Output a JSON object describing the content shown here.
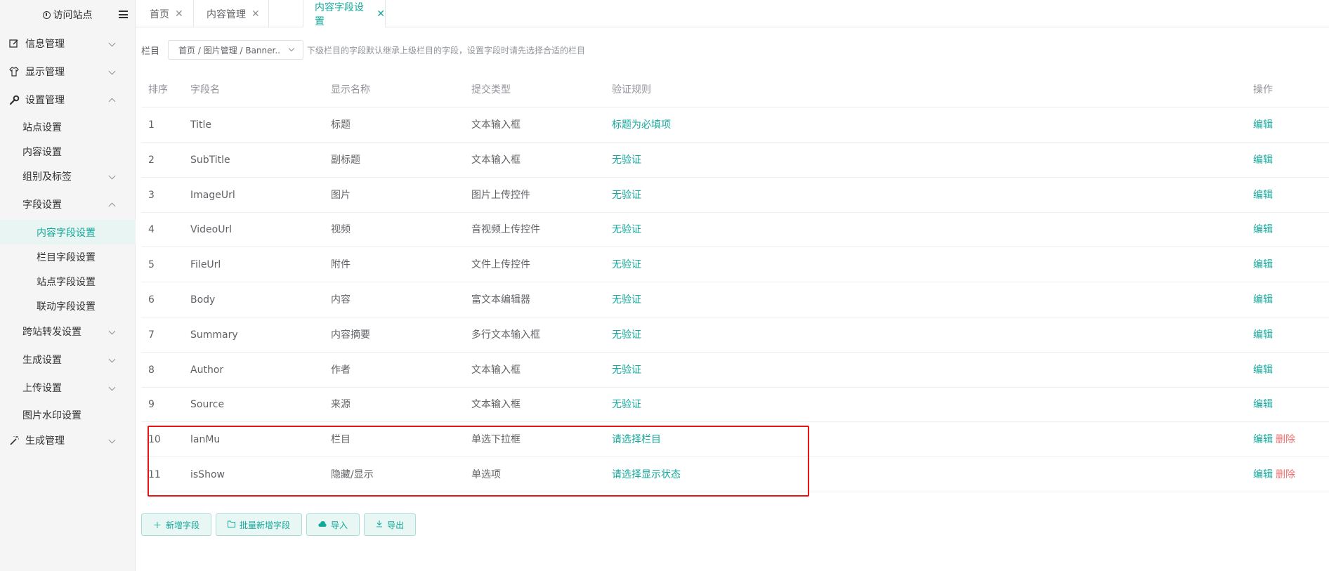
{
  "sidebar": {
    "visit_site": "访问站点",
    "menus": [
      {
        "label": "信息管理",
        "icon": "edit-icon"
      },
      {
        "label": "显示管理",
        "icon": "shirt-icon"
      },
      {
        "label": "设置管理",
        "icon": "wrench-icon"
      }
    ],
    "settings_children": {
      "site_settings": "站点设置",
      "content_settings": "内容设置",
      "groups_tags": "组别及标签",
      "field_settings": "字段设置",
      "field_children": [
        "内容字段设置",
        "栏目字段设置",
        "站点字段设置",
        "联动字段设置"
      ],
      "cross_site": "跨站转发设置",
      "generate_settings": "生成设置",
      "upload_settings": "上传设置",
      "watermark_settings": "图片水印设置"
    },
    "generate_management": "生成管理"
  },
  "tabs": [
    {
      "label": "首页",
      "close": "✕"
    },
    {
      "label": "内容管理",
      "close": "✕"
    },
    {
      "label": "内容字段设置",
      "close": "✕"
    }
  ],
  "filter": {
    "label": "栏目",
    "value": "首页 / 图片管理 / Banner...",
    "hint": "下级栏目的字段默认继承上级栏目的字段，设置字段时请先选择合适的栏目"
  },
  "table": {
    "headers": [
      "排序",
      "字段名",
      "显示名称",
      "提交类型",
      "验证规则",
      "操作"
    ],
    "edit_label": "编辑",
    "delete_label": "删除",
    "rows": [
      {
        "order": "1",
        "field": "Title",
        "display": "标题",
        "type": "文本输入框",
        "rule": "标题为必填项"
      },
      {
        "order": "2",
        "field": "SubTitle",
        "display": "副标题",
        "type": "文本输入框",
        "rule": "无验证"
      },
      {
        "order": "3",
        "field": "ImageUrl",
        "display": "图片",
        "type": "图片上传控件",
        "rule": "无验证"
      },
      {
        "order": "4",
        "field": "VideoUrl",
        "display": "视频",
        "type": "音视频上传控件",
        "rule": "无验证"
      },
      {
        "order": "5",
        "field": "FileUrl",
        "display": "附件",
        "type": "文件上传控件",
        "rule": "无验证"
      },
      {
        "order": "6",
        "field": "Body",
        "display": "内容",
        "type": "富文本编辑器",
        "rule": "无验证"
      },
      {
        "order": "7",
        "field": "Summary",
        "display": "内容摘要",
        "type": "多行文本输入框",
        "rule": "无验证"
      },
      {
        "order": "8",
        "field": "Author",
        "display": "作者",
        "type": "文本输入框",
        "rule": "无验证"
      },
      {
        "order": "9",
        "field": "Source",
        "display": "来源",
        "type": "文本输入框",
        "rule": "无验证"
      },
      {
        "order": "10",
        "field": "lanMu",
        "display": "栏目",
        "type": "单选下拉框",
        "rule": "请选择栏目",
        "deletable": true
      },
      {
        "order": "11",
        "field": "isShow",
        "display": "隐藏/显示",
        "type": "单选项",
        "rule": "请选择显示状态",
        "deletable": true
      }
    ]
  },
  "buttons": [
    {
      "label": "新增字段",
      "icon": "plus-icon"
    },
    {
      "label": "批量新增字段",
      "icon": "folder-plus-icon"
    },
    {
      "label": "导入",
      "icon": "cloud-upload-icon"
    },
    {
      "label": "导出",
      "icon": "download-icon"
    }
  ],
  "colors": {
    "accent": "#13a89b",
    "danger": "#f56c6c",
    "highlight": "#e81414"
  }
}
